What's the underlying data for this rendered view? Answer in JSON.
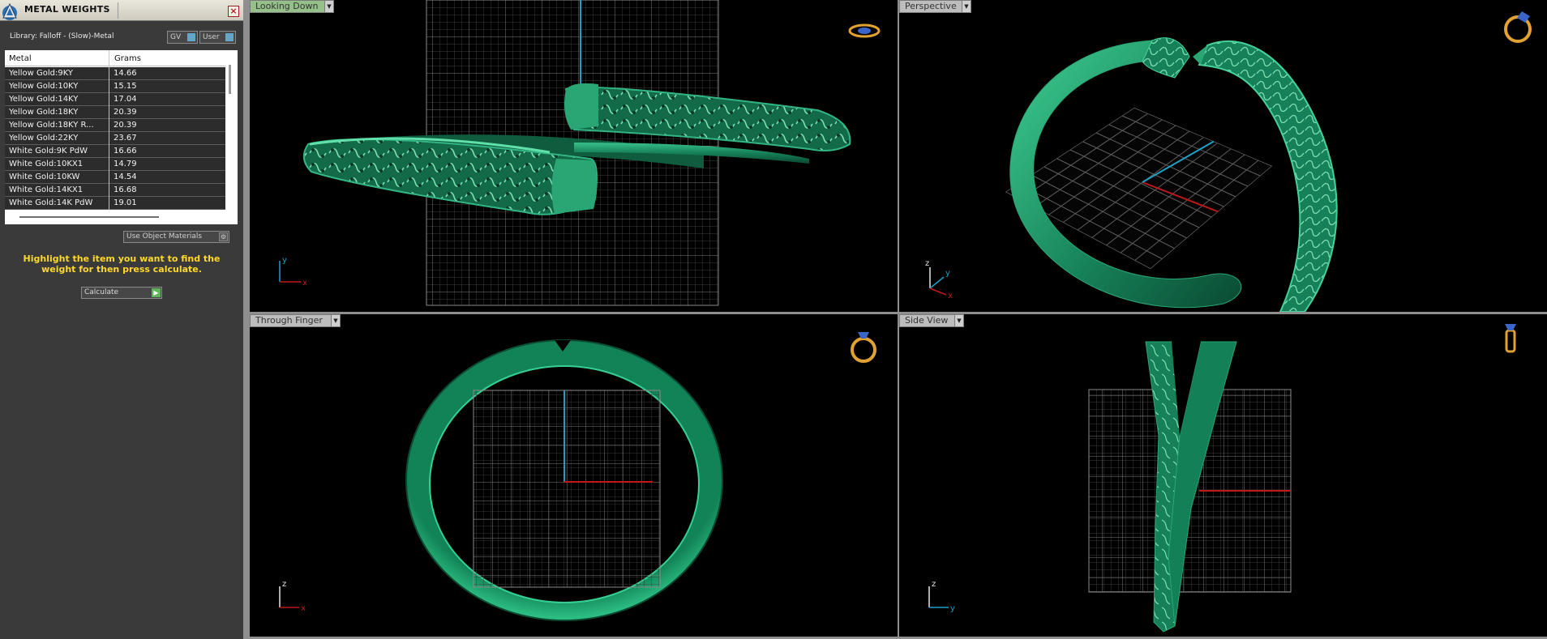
{
  "panel": {
    "title": "METAL WEIGHTS",
    "close": "×",
    "library": "Library: Falloff - (Slow)-Metal",
    "gv_label": "GV",
    "user_label": "User",
    "use_object_materials": "Use Object Materials",
    "instruction": "Highlight the item you want to find the weight for then press calculate.",
    "calculate_label": "Calculate",
    "table": {
      "headers": [
        "Metal",
        "Grams"
      ],
      "rows": [
        {
          "metal": "Yellow Gold:9KY",
          "grams": "14.66"
        },
        {
          "metal": "Yellow Gold:10KY",
          "grams": "15.15"
        },
        {
          "metal": "Yellow Gold:14KY",
          "grams": "17.04"
        },
        {
          "metal": "Yellow Gold:18KY",
          "grams": "20.39"
        },
        {
          "metal": "Yellow Gold:18KY R...",
          "grams": "20.39"
        },
        {
          "metal": "Yellow Gold:22KY",
          "grams": "23.67"
        },
        {
          "metal": "White Gold:9K PdW",
          "grams": "16.66"
        },
        {
          "metal": "White Gold:10KX1",
          "grams": "14.79"
        },
        {
          "metal": "White Gold:10KW",
          "grams": "14.54"
        },
        {
          "metal": "White Gold:14KX1",
          "grams": "16.68"
        },
        {
          "metal": "White Gold:14K PdW",
          "grams": "19.01"
        }
      ]
    }
  },
  "viewports": {
    "top_left": {
      "label": "Looking Down",
      "axes": {
        "v": "y",
        "h": "x"
      }
    },
    "top_right": {
      "label": "Perspective",
      "axes": {
        "v": "z",
        "d": "y",
        "h": "x"
      }
    },
    "bottom_left": {
      "label": "Through Finger",
      "axes": {
        "v": "z",
        "h": "x"
      }
    },
    "bottom_right": {
      "label": "Side View",
      "axes": {
        "v": "z",
        "h": "y"
      }
    }
  },
  "colors": {
    "ring_green": "#1c8a5e",
    "grid_line": "#6e6e6e",
    "axis_red": "#c01818",
    "axis_blue": "#1f9fc4",
    "highlight_yellow": "#ffd829",
    "active_tab": "#96c089"
  }
}
